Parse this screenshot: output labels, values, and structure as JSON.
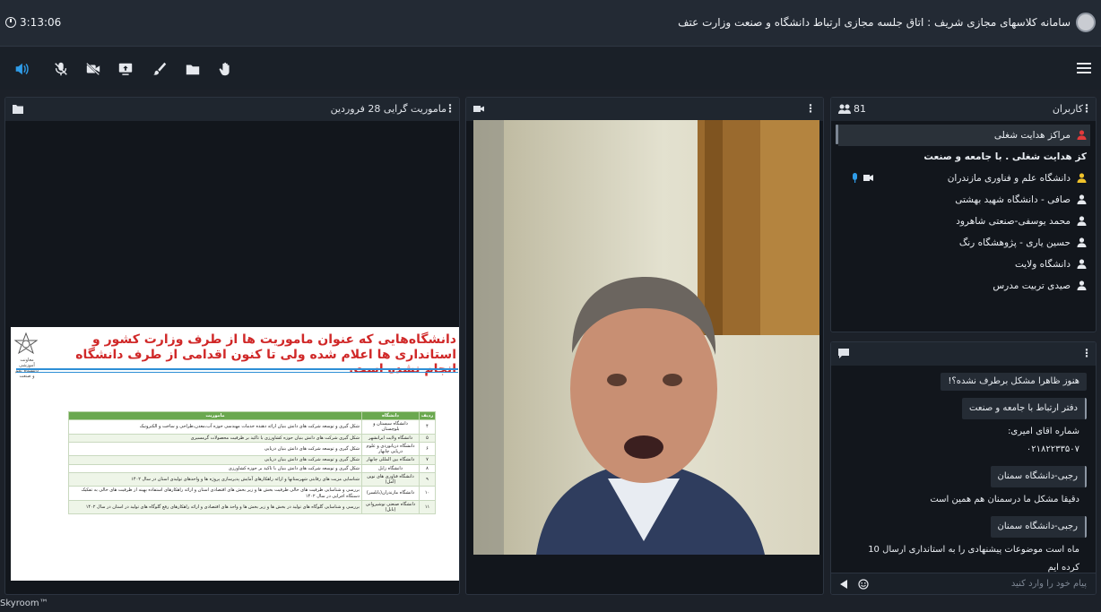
{
  "app": {
    "title": "سامانه کلاسهای مجازی شریف : اتاق جلسه مجازی ارتباط دانشگاه و صنعت وزارت عتف",
    "clock": "3:13:06",
    "footer": "Skyroom™"
  },
  "toolbar": {
    "icons": [
      "speaker-icon",
      "mic-off-icon",
      "camera-off-icon",
      "screen-share-icon",
      "brush-icon",
      "folder-icon",
      "hand-icon"
    ],
    "accent_color": "#2f9ce8"
  },
  "presentation": {
    "title": "ماموریت گرایی 28 فروردین",
    "slide": {
      "heading": "دانشگاه‌هایی که عنوان ماموریت ها از طرف وزارت کشور و استانداری ها اعلام شده ولی تا کنون اقدامی از طرف دانشگاه انجام نشده است.",
      "institution": "معاونت آموزشی دانشگاه علم و صنعت",
      "table_headers": [
        "ردیف",
        "دانشگاه",
        "ماموریت"
      ],
      "table_rows": [
        [
          "۴",
          "دانشگاه سیستان و بلوچستان",
          "شکل گیری و توسعه شرکت های دانش بنیان ارائه دهنده خدمات مهندسی حوزه آب،معدن،طراحی و ساخت و الکترونیک"
        ],
        [
          "۵",
          "دانشگاه ولایت ایرانشهر",
          "شکل گیری شرکت های دانش بنیان حوزه کشاورزی با تاکید بر ظرفیت محصولات گرمسیری"
        ],
        [
          "۶",
          "دانشگاه دریانوردی و علوم دریایی چابهار",
          "شکل گیری و توسعه شرکت های دانش بنیان دریایی"
        ],
        [
          "۷",
          "دانشگاه بین المللی چابهار",
          "شکل گیری و توسعه شرکت های دانش بنیان دریایی"
        ],
        [
          "۸",
          "دانشگاه زابل",
          "شکل گیری و توسعه شرکت های دانش بنیان با تاکید بر حوزه کشاورزی"
        ],
        [
          "۹",
          "دانشگاه فناوری های نوین (آمل)",
          "شناسایی مزیت های رقابتی شهرستانها و ارائه راهکارهای آمایش پذیرسازی پروژه ها و واحدهای تولیدی استان در سال ۱۴۰۲"
        ],
        [
          "۱۰",
          "دانشگاه مازندران(بابلسر)",
          "بررسی و شناسایی ظرفیت های خالی ظرفیت بخش ها و زیر بخش های اقتصادی استان و ارائه راهکارهای استفاده بهینه از ظرفیت های خالی به تفکیک دستگاه اجرایی در سال ۱۴۰۲"
        ],
        [
          "۱۱",
          "دانشگاه صنعتی نوشیروانی (بابل)",
          "بررسی و شناسایی گلوگاه های تولید در بخش ها و زیر بخش ها و واحد های اقتصادی و ارائه راهکارهای رفع گلوگاه های تولید در استان در سال ۱۴۰۲"
        ]
      ]
    }
  },
  "users": {
    "title": "کاربران",
    "count": "81",
    "items": [
      {
        "name": "مراکز هدایت شغلی",
        "icon": "user-red-icon",
        "highlight": true
      },
      {
        "name": "کز هدایت شغلی . با جامعه و صنعت",
        "icon": "",
        "highlight": false
      },
      {
        "name": "دانشگاه علم و فناوری مازندران",
        "icon": "user-yellow-icon",
        "highlight": false,
        "media": true
      },
      {
        "name": "صافی - دانشگاه شهید بهشتی",
        "icon": "user-icon",
        "highlight": false
      },
      {
        "name": "محمد یوسفی-صنعتی شاهرود",
        "icon": "user-icon",
        "highlight": false
      },
      {
        "name": "حسین یاری - پژوهشگاه رنگ",
        "icon": "user-icon",
        "highlight": false
      },
      {
        "name": "دانشگاه ولایت",
        "icon": "user-icon",
        "highlight": false
      },
      {
        "name": "صیدی تربیت مدرس",
        "icon": "user-icon",
        "highlight": false
      }
    ]
  },
  "chat": {
    "messages": [
      {
        "lines": [
          "هنوز ظاهرا مشکل برطرف نشده؟!"
        ],
        "author": false
      },
      {
        "lines": [
          "دفتر ارتباط با جامعه و صنعت"
        ],
        "author": true
      },
      {
        "lines": [
          "شماره اقای امیری:",
          "۰۲۱۸۲۲۳۳۵۰۷"
        ],
        "author": false
      },
      {
        "lines": [
          "رجبی-دانشگاه سمنان"
        ],
        "author": true
      },
      {
        "lines": [
          "دقیقا مشکل ما درسمنان هم همین است"
        ],
        "author": false
      },
      {
        "lines": [
          "رجبی-دانشگاه سمنان"
        ],
        "author": true
      },
      {
        "lines": [
          "ماه است موضوعات پیشنهادی را به استانداری ارسال 10",
          "کرده ایم"
        ],
        "author": false
      }
    ],
    "placeholder": "پیام خود را وارد کنید"
  }
}
